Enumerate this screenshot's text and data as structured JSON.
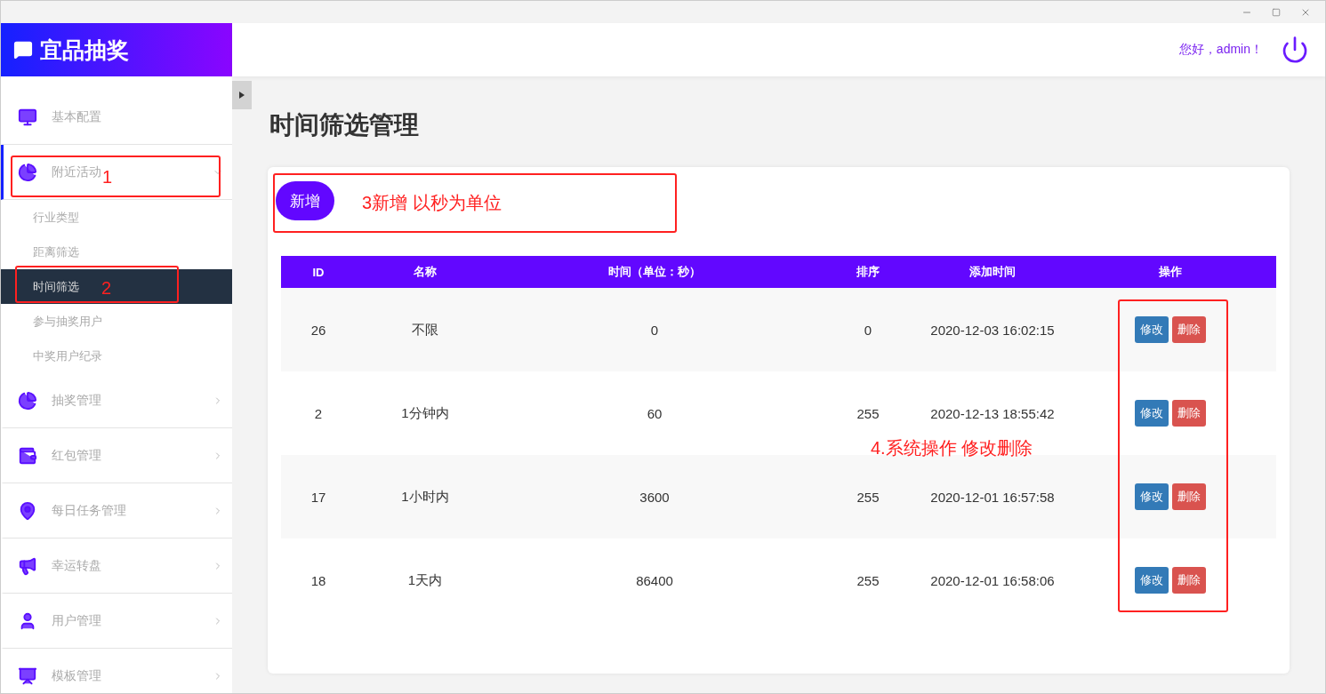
{
  "brand": {
    "title": "宜品抽奖"
  },
  "header": {
    "greeting": "您好，admin！"
  },
  "sidebar": {
    "items": [
      {
        "label": "基本配置",
        "selected": false
      },
      {
        "label": "附近活动",
        "expanded": true,
        "selected": true,
        "children": [
          {
            "label": "行业类型",
            "selected": false
          },
          {
            "label": "距离筛选",
            "selected": false
          },
          {
            "label": "时间筛选",
            "selected": true
          },
          {
            "label": "参与抽奖用户",
            "selected": false
          },
          {
            "label": "中奖用户纪录",
            "selected": false
          }
        ]
      },
      {
        "label": "抽奖管理",
        "expanded": false,
        "selected": false
      },
      {
        "label": "红包管理",
        "expanded": false,
        "selected": false
      },
      {
        "label": "每日任务管理",
        "expanded": false,
        "selected": false
      },
      {
        "label": "幸运转盘",
        "expanded": false,
        "selected": false
      },
      {
        "label": "用户管理",
        "expanded": false,
        "selected": false
      },
      {
        "label": "模板管理",
        "expanded": false,
        "selected": false
      }
    ]
  },
  "page": {
    "title": "时间筛选管理",
    "add_button": "新增"
  },
  "table": {
    "columns": [
      "ID",
      "名称",
      "时间（单位：秒）",
      "排序",
      "添加时间",
      "操作"
    ],
    "rows": [
      {
        "id": "26",
        "name": "不限",
        "seconds": "0",
        "order": "0",
        "added": "2020-12-03 16:02:15",
        "actions": [
          "修改",
          "删除"
        ]
      },
      {
        "id": "2",
        "name": "1分钟内",
        "seconds": "60",
        "order": "255",
        "added": "2020-12-13 18:55:42",
        "actions": [
          "修改",
          "删除"
        ]
      },
      {
        "id": "17",
        "name": "1小时内",
        "seconds": "3600",
        "order": "255",
        "added": "2020-12-01 16:57:58",
        "actions": [
          "修改",
          "删除"
        ]
      },
      {
        "id": "18",
        "name": "1天内",
        "seconds": "86400",
        "order": "255",
        "added": "2020-12-01 16:58:06",
        "actions": [
          "修改",
          "删除"
        ]
      }
    ]
  },
  "annotations": [
    "1",
    "2",
    "3新增 以秒为单位",
    "4.系统操作 修改删除"
  ]
}
